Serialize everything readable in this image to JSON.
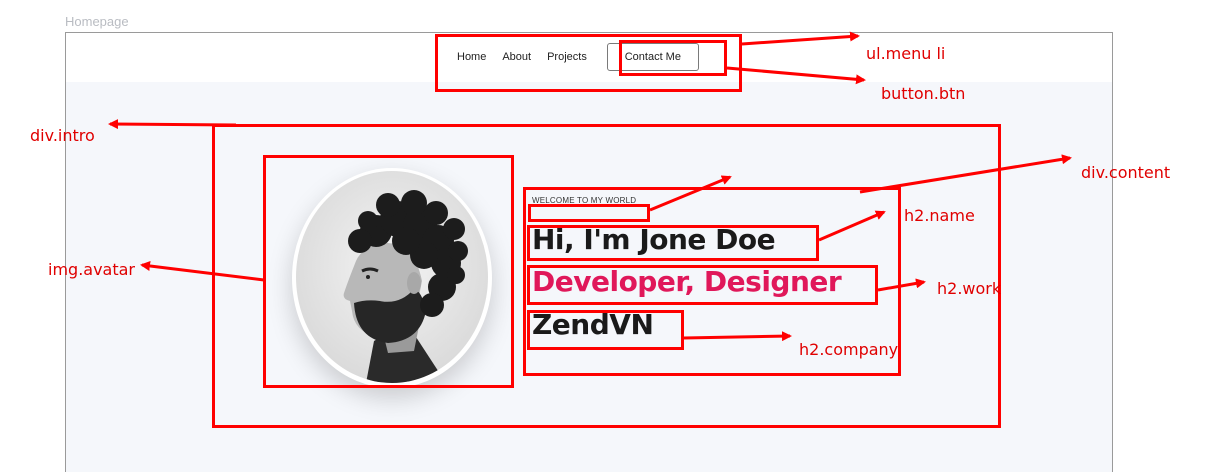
{
  "page_label": "Homepage",
  "nav": {
    "items": [
      "Home",
      "About",
      "Projects"
    ],
    "button": "Contact Me"
  },
  "intro": {
    "welcome": "WELCOME TO MY WORLD",
    "name": "Hi, I'm Jone Doe",
    "work": "Developer, Designer",
    "company": "ZendVN"
  },
  "annotations": {
    "menu": "ul.menu li",
    "button": "button.btn",
    "intro": "div.intro",
    "content": "div.content",
    "avatar": "img.avatar",
    "name": "h2.name",
    "work": "h2.work",
    "company": "h2.company"
  },
  "colors": {
    "annotation": "#ff0000",
    "accent": "#e0185a"
  }
}
